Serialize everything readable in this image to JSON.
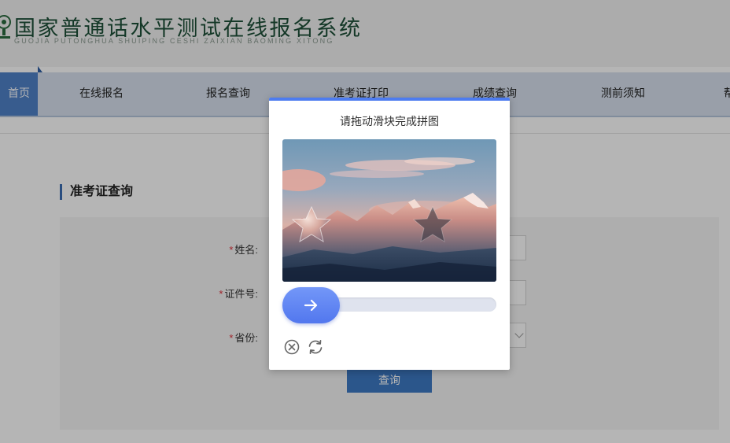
{
  "site": {
    "title": "国家普通话水平测试在线报名系统",
    "subtitle": "GUOJIA PUTONGHUA SHUIPING CESHI ZAIXIAN BAOMING XITONG"
  },
  "nav": {
    "items": [
      {
        "label": "首页",
        "active": true
      },
      {
        "label": "在线报名"
      },
      {
        "label": "报名查询"
      },
      {
        "label": "准考证打印"
      },
      {
        "label": "成绩查询"
      },
      {
        "label": "测前须知"
      },
      {
        "label": "帮"
      }
    ]
  },
  "section": {
    "title": "准考证查询"
  },
  "form": {
    "required_mark": "*",
    "name_label": "姓名:",
    "id_label": "证件号:",
    "province_label": "省份:",
    "query_button": "查询"
  },
  "captcha": {
    "title": "请拖动滑块完成拼图",
    "slider_progress": 0,
    "piece_shape": "star",
    "icons": [
      "arrow-right-icon",
      "close-circle-icon",
      "refresh-icon"
    ]
  },
  "colors": {
    "brand_green": "#1d4f38",
    "nav_active": "#4f82c9",
    "nav_bg": "#d8e1ee",
    "button_blue": "#3d7ac4",
    "slider_blue": "#5a80f1",
    "required_red": "#e0303a"
  }
}
